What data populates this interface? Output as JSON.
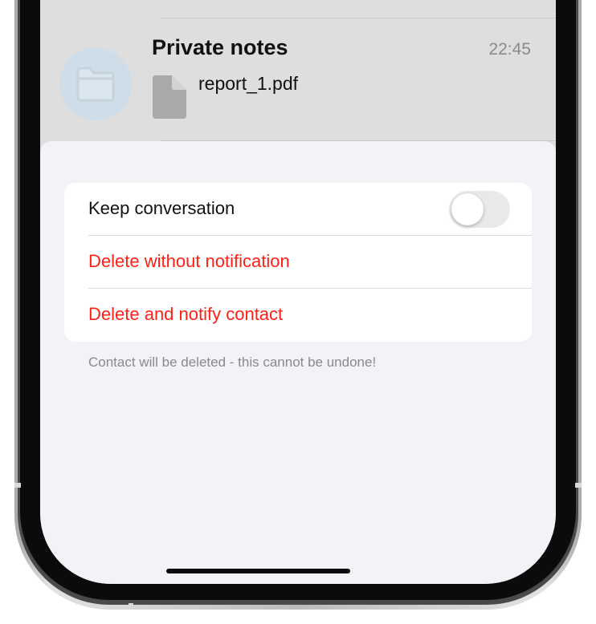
{
  "chat": {
    "title": "Private notes",
    "time": "22:45",
    "attachment_name": "report_1.pdf",
    "avatar_icon": "folder-icon",
    "attachment_icon": "document-icon"
  },
  "sheet": {
    "keep_conversation_label": "Keep conversation",
    "keep_conversation_enabled": false,
    "delete_without_notification_label": "Delete without notification",
    "delete_and_notify_label": "Delete and notify contact",
    "footer_note": "Contact will be deleted - this cannot be undone!"
  },
  "colors": {
    "destructive": "#ff2015",
    "sheet_background": "#f2f2f7",
    "toggle_off": "#e9e9ea",
    "secondary_text": "#8a8a8e"
  }
}
